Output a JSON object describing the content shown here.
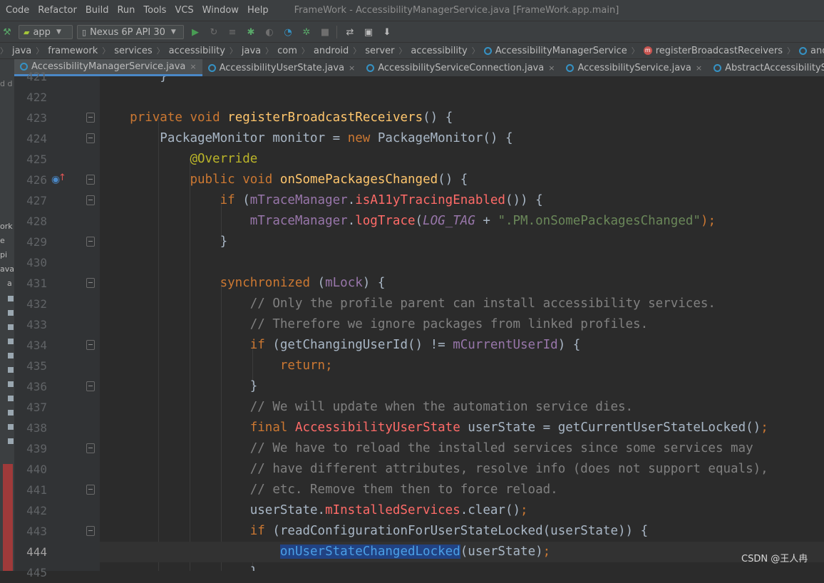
{
  "menubar": {
    "items": [
      "Code",
      "Refactor",
      "Build",
      "Run",
      "Tools",
      "VCS",
      "Window",
      "Help"
    ],
    "window_title": "FrameWork - AccessibilityManagerService.java [FrameWork.app.main]"
  },
  "toolbar": {
    "module": "app",
    "device": "Nexus 6P API 30",
    "icons": [
      "hammer-icon",
      "run-icon",
      "apply-changes-icon",
      "apply-code-icon",
      "debug-icon",
      "attach-debugger-icon",
      "profile-icon",
      "coverage-icon",
      "stop-icon",
      "sync-icon",
      "avd-manager-icon",
      "sdk-manager-icon"
    ]
  },
  "breadcrumbs": [
    "java",
    "framework",
    "services",
    "accessibility",
    "java",
    "com",
    "android",
    "server",
    "accessibility",
    "AccessibilityManagerService",
    "registerBroadcastReceivers",
    "anonymous PackageMonitor"
  ],
  "tabs": [
    {
      "label": "AccessibilityManagerService.java",
      "active": true
    },
    {
      "label": "AccessibilityUserState.java",
      "active": false
    },
    {
      "label": "AccessibilityServiceConnection.java",
      "active": false
    },
    {
      "label": "AccessibilityService.java",
      "active": false
    },
    {
      "label": "AbstractAccessibilityServiceConnection.ja",
      "active": false
    }
  ],
  "sidebar_fragments": [
    "d d",
    "ork",
    "e",
    "pi",
    "ava",
    "a"
  ],
  "editor": {
    "current_line": "444",
    "line_numbers": [
      "421",
      "422",
      "423",
      "424",
      "425",
      "426",
      "427",
      "428",
      "429",
      "430",
      "431",
      "432",
      "433",
      "434",
      "435",
      "436",
      "437",
      "438",
      "439",
      "440",
      "441",
      "442",
      "443",
      "444",
      "445"
    ],
    "code": {
      "l423": {
        "kw1": "private",
        "kw2": "void",
        "name": "registerBroadcastReceivers",
        "rest": "() {"
      },
      "l424": {
        "type": "PackageMonitor",
        "var": " monitor = ",
        "kw": "new",
        "rest": " PackageMonitor() {"
      },
      "l425": {
        "annotation": "@Override"
      },
      "l426": {
        "kw1": "public",
        "kw2": "void",
        "name": "onSomePackagesChanged",
        "rest": "() {"
      },
      "l427": {
        "kw": "if",
        "open": " (",
        "field": "mTraceManager",
        "dot": ".",
        "method": "isA11yTracingEnabled",
        "close": "()) {"
      },
      "l428": {
        "field": "mTraceManager",
        "dot": ".",
        "method": "logTrace",
        "open": "(",
        "const": "LOG_TAG",
        "plus": " + ",
        "string": "\".PM.onSomePackagesChanged\"",
        "close": ");"
      },
      "l429": "}",
      "l431": {
        "kw": "synchronized",
        "open": " (",
        "field": "mLock",
        "close": ") {"
      },
      "l432": "// Only the profile parent can install accessibility services.",
      "l433": "// Therefore we ignore packages from linked profiles.",
      "l434": {
        "kw": "if",
        "mid": " (getChangingUserId() != ",
        "field": "mCurrentUserId",
        "close": ") {"
      },
      "l435": {
        "kw": "return",
        "semi": ";"
      },
      "l436": "}",
      "l437": "// We will update when the automation service dies.",
      "l438": {
        "kw": "final",
        "type": "AccessibilityUserState",
        "rest": " userState = getCurrentUserStateLocked()",
        "semi": ";"
      },
      "l439": "// We have to reload the installed services since some services may",
      "l440": "// have different attributes, resolve info (does not support equals),",
      "l441": "// etc. Remove them then to force reload.",
      "l442": {
        "var": "userState.",
        "field": "mInstalledServices",
        "rest": ".clear()",
        "semi": ";"
      },
      "l443": {
        "kw": "if",
        "rest": " (readConfigurationForUserStateLocked(userState)) {"
      },
      "l444": {
        "selected": "onUserStateChangedLocked",
        "rest": "(userState)",
        "semi": ";"
      },
      "l445": "}"
    }
  },
  "watermark": "CSDN @王人冉",
  "colors": {
    "keyword": "#cc7832",
    "method": "#ffc66d",
    "annotation": "#bbb529",
    "field": "#9876aa",
    "string": "#6a8759",
    "comment": "#808080",
    "error_type": "#ff6b68",
    "selection": "#214283"
  }
}
